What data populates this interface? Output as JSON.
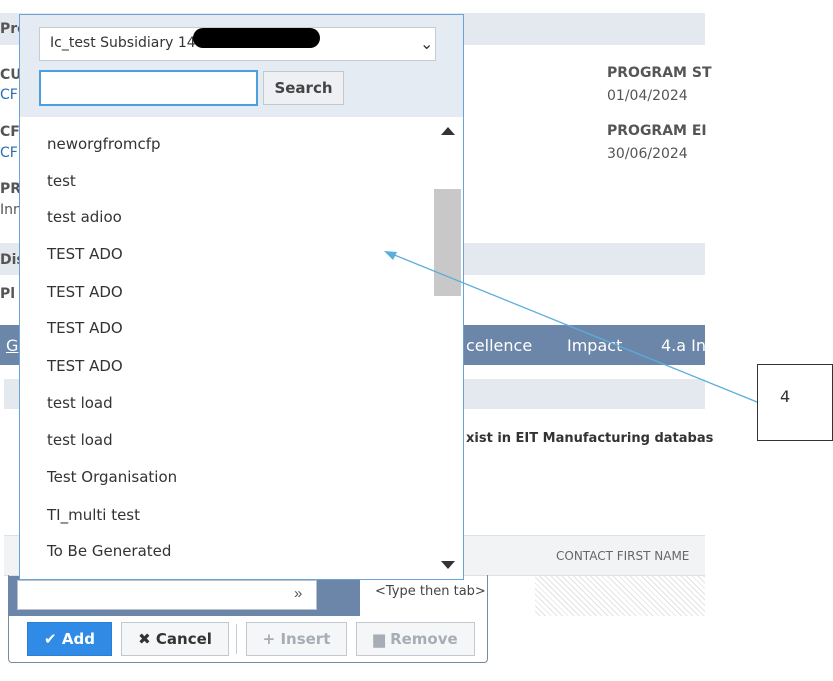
{
  "background": {
    "program_start_label": "PROGRAM ST",
    "program_start_value": "01/04/2024",
    "program_end_label": "PROGRAM EI",
    "program_end_value": "30/06/2024",
    "left_frag": {
      "pr": "Pro",
      "cu": "CU",
      "cr1": "CF",
      "cf": "CF",
      "cr2": "CF",
      "pr2": "PR",
      "inn": "Inn",
      "dis": "Dis",
      "pl": "Pl"
    },
    "tabs": [
      {
        "label": "G"
      },
      {
        "label": "cellence"
      },
      {
        "label": "Impact"
      },
      {
        "label": "4.a In"
      }
    ],
    "notice_text": "xist in EIT Manufacturing databas",
    "column_header": "CONTACT FIRST NAME",
    "type_then_tab": "<Type then tab>"
  },
  "dropdown": {
    "selected": "Ic_test Subsidiary 14",
    "search_placeholder": "",
    "search_button": "Search",
    "options": [
      "neworgfromcfp",
      "test",
      "test adioo",
      "TEST ADO",
      "TEST ADO",
      "TEST ADO",
      "TEST ADO",
      "test load",
      "test load",
      "Test Organisation",
      "TI_multi test",
      "To Be Generated"
    ]
  },
  "buttons": {
    "add": "Add",
    "cancel": "Cancel",
    "insert": "Insert",
    "remove": "Remove"
  },
  "annotation": {
    "label": "4",
    "color": "#5aaedc"
  },
  "colors": {
    "accent": "#2f8be6",
    "tabbar": "#6b86a8",
    "header_band": "#e4e9ef"
  }
}
